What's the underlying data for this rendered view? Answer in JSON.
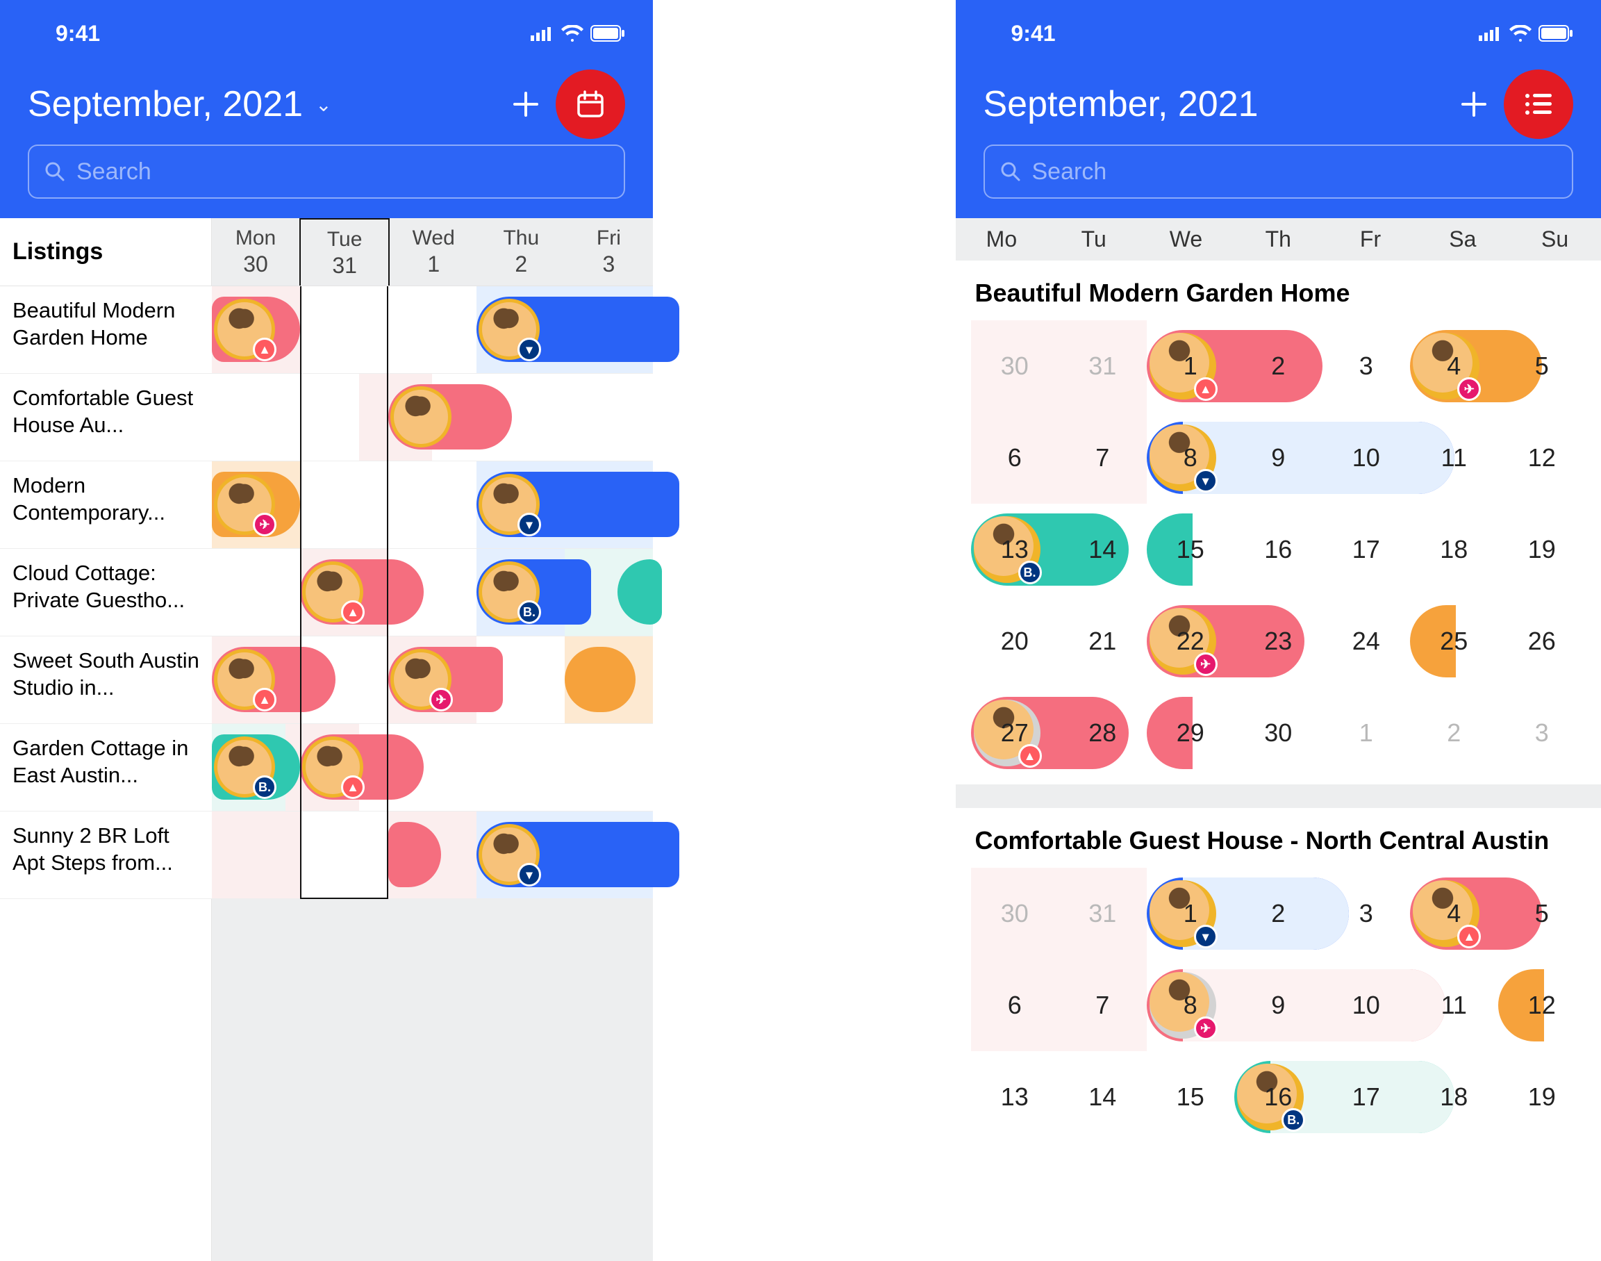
{
  "status": {
    "time": "9:41"
  },
  "header": {
    "title": "September, 2021",
    "search_placeholder": "Search"
  },
  "left": {
    "listings_heading": "Listings",
    "days": [
      {
        "name": "Mon",
        "num": "30"
      },
      {
        "name": "Tue",
        "num": "31"
      },
      {
        "name": "Wed",
        "num": "1"
      },
      {
        "name": "Thu",
        "num": "2"
      },
      {
        "name": "Fri",
        "num": "3"
      }
    ],
    "highlighted_day_index": 1,
    "rows": [
      {
        "label": "Beautiful Modern Garden Home",
        "cells": [
          "lt",
          "",
          "",
          "bl",
          "bl"
        ],
        "bookings": [
          {
            "start": 0,
            "span": 1,
            "color": "c-pink",
            "shape": "rnd-right",
            "badge": "airbnb",
            "badge_text": "▲"
          },
          {
            "start": 3,
            "span": 2.3,
            "color": "c-blue",
            "shape": "",
            "badge": "booking",
            "badge_text": "▾"
          }
        ]
      },
      {
        "label": "Comfortable Guest House Au...",
        "cells": [
          "",
          "",
          "lt",
          "",
          "",
          ""
        ],
        "bookings": [
          {
            "start": 2,
            "span": 1.4,
            "color": "c-pink",
            "shape": "rnd-both",
            "badge": "",
            "badge_text": ""
          }
        ]
      },
      {
        "label": "Modern Contemporary...",
        "cells": [
          "or",
          "",
          "",
          "bl",
          "bl"
        ],
        "bookings": [
          {
            "start": 0,
            "span": 1,
            "color": "c-orange",
            "shape": "rnd-right",
            "badge": "pink",
            "badge_text": "✈"
          },
          {
            "start": 3,
            "span": 2.3,
            "color": "c-blue",
            "shape": "",
            "badge": "booking",
            "badge_text": "▾"
          }
        ]
      },
      {
        "label": "Cloud Cottage: Private Guestho...",
        "cells": [
          "",
          "lt",
          "",
          "bl",
          "teal"
        ],
        "bookings": [
          {
            "start": 1,
            "span": 1.4,
            "color": "c-pink",
            "shape": "rnd-both",
            "badge": "airbnb",
            "badge_text": "▲"
          },
          {
            "start": 3,
            "span": 1.3,
            "color": "c-blue",
            "shape": "",
            "badge": "booking",
            "badge_text": "B."
          },
          {
            "start": 4.6,
            "span": 0.5,
            "color": "c-teal",
            "shape": "",
            "badge": "",
            "badge_text": "",
            "noav": true
          }
        ]
      },
      {
        "label": "Sweet South Austin Studio in...",
        "cells": [
          "lt",
          "",
          "lt",
          "",
          "or"
        ],
        "bookings": [
          {
            "start": 0,
            "span": 1.4,
            "color": "c-pink",
            "shape": "rnd-both",
            "badge": "airbnb",
            "badge_text": "▲"
          },
          {
            "start": 2,
            "span": 1.3,
            "color": "c-pink",
            "shape": "",
            "badge": "pink",
            "badge_text": "✈"
          },
          {
            "start": 4,
            "span": 0.8,
            "color": "c-orange",
            "shape": "rnd-both",
            "badge": "",
            "badge_text": "",
            "noav": true
          }
        ]
      },
      {
        "label": "Garden Cottage in East Austin...",
        "cells": [
          "teal",
          "lt",
          "",
          "",
          "",
          ""
        ],
        "bookings": [
          {
            "start": 0,
            "span": 1,
            "color": "c-teal",
            "shape": "rnd-right",
            "badge": "booking",
            "badge_text": "B."
          },
          {
            "start": 1,
            "span": 1.4,
            "color": "c-pink",
            "shape": "rnd-both",
            "badge": "airbnb",
            "badge_text": "▲"
          }
        ]
      },
      {
        "label": "Sunny 2 BR Loft Apt Steps from...",
        "cells": [
          "lt",
          "",
          "lt",
          "bl",
          "bl"
        ],
        "bookings": [
          {
            "start": 2,
            "span": 0.6,
            "color": "c-pink",
            "shape": "rnd-right",
            "badge": "",
            "badge_text": "",
            "noav": true
          },
          {
            "start": 3,
            "span": 2.3,
            "color": "c-blue",
            "shape": "",
            "badge": "booking",
            "badge_text": "▾"
          }
        ]
      }
    ]
  },
  "right": {
    "weekdays": [
      "Mo",
      "Tu",
      "We",
      "Th",
      "Fr",
      "Sa",
      "Su"
    ],
    "sections": [
      {
        "title": "Beautiful Modern Garden Home",
        "weeks": [
          {
            "days": [
              {
                "n": "30",
                "muted": true,
                "lt": true
              },
              {
                "n": "31",
                "muted": true,
                "lt": true
              },
              {
                "n": "1"
              },
              {
                "n": "2"
              },
              {
                "n": "3"
              },
              {
                "n": "4"
              },
              {
                "n": "5"
              }
            ],
            "bookings": [
              {
                "col": 2,
                "span": 2,
                "color": "c-pink",
                "badge": "airbnb",
                "bt": "▲"
              },
              {
                "col": 5,
                "span": 1.5,
                "color": "c-orange",
                "badge": "pink",
                "bt": "✈"
              }
            ]
          },
          {
            "days": [
              {
                "n": "6",
                "lt": true
              },
              {
                "n": "7",
                "lt": true
              },
              {
                "n": "8"
              },
              {
                "n": "9"
              },
              {
                "n": "10"
              },
              {
                "n": "11"
              },
              {
                "n": "12"
              }
            ],
            "bookings": [
              {
                "col": 2,
                "span": 3.5,
                "color": "c-blue",
                "badge": "booking",
                "bt": "▾",
                "tint": "#e4effe"
              }
            ]
          },
          {
            "days": [
              {
                "n": "13"
              },
              {
                "n": "14"
              },
              {
                "n": "15"
              },
              {
                "n": "16"
              },
              {
                "n": "17"
              },
              {
                "n": "18"
              },
              {
                "n": "19"
              }
            ],
            "bookings": [
              {
                "col": 0,
                "span": 1.8,
                "color": "c-teal",
                "badge": "booking",
                "bt": "B."
              },
              {
                "col": 2,
                "span": 0.5,
                "color": "c-teal",
                "half": "left"
              }
            ]
          },
          {
            "days": [
              {
                "n": "20"
              },
              {
                "n": "21"
              },
              {
                "n": "22"
              },
              {
                "n": "23"
              },
              {
                "n": "24"
              },
              {
                "n": "25"
              },
              {
                "n": "26"
              }
            ],
            "bookings": [
              {
                "col": 2,
                "span": 1.8,
                "color": "c-pink",
                "badge": "pink",
                "bt": "✈"
              },
              {
                "col": 5,
                "span": 0.5,
                "color": "c-orange",
                "half": "left"
              }
            ]
          },
          {
            "days": [
              {
                "n": "27"
              },
              {
                "n": "28"
              },
              {
                "n": "29"
              },
              {
                "n": "30"
              },
              {
                "n": "1",
                "muted": true
              },
              {
                "n": "2",
                "muted": true
              },
              {
                "n": "3",
                "muted": true
              }
            ],
            "bookings": [
              {
                "col": 0,
                "span": 1.8,
                "color": "c-pink",
                "badge": "airbnb",
                "bt": "▲",
                "avbg": "#d3d3d3"
              },
              {
                "col": 2,
                "span": 0.5,
                "color": "c-pink",
                "half": "left"
              }
            ]
          }
        ]
      },
      {
        "title": "Comfortable Guest House - North Central Austin",
        "weeks": [
          {
            "days": [
              {
                "n": "30",
                "muted": true,
                "lt": true
              },
              {
                "n": "31",
                "muted": true,
                "lt": true
              },
              {
                "n": "1"
              },
              {
                "n": "2"
              },
              {
                "n": "3"
              },
              {
                "n": "4"
              },
              {
                "n": "5"
              }
            ],
            "bookings": [
              {
                "col": 2,
                "span": 2.3,
                "color": "c-blue",
                "badge": "booking",
                "bt": "▾",
                "tint": "#e4effe"
              },
              {
                "col": 5,
                "span": 1.5,
                "color": "c-pink",
                "badge": "airbnb",
                "bt": "▲"
              }
            ]
          },
          {
            "days": [
              {
                "n": "6",
                "lt": true
              },
              {
                "n": "7",
                "lt": true
              },
              {
                "n": "8"
              },
              {
                "n": "9"
              },
              {
                "n": "10"
              },
              {
                "n": "11"
              },
              {
                "n": "12"
              }
            ],
            "bookings": [
              {
                "col": 2,
                "span": 3.4,
                "color": "c-pink",
                "badge": "pink",
                "bt": "✈",
                "tint": "#fdf2f2",
                "avbg": "#d3d3d3"
              },
              {
                "col": 6,
                "span": 0.5,
                "color": "c-orange",
                "half": "left"
              }
            ]
          },
          {
            "days": [
              {
                "n": "13"
              },
              {
                "n": "14"
              },
              {
                "n": "15"
              },
              {
                "n": "16"
              },
              {
                "n": "17"
              },
              {
                "n": "18"
              },
              {
                "n": "19"
              }
            ],
            "bookings": [
              {
                "col": 3,
                "span": 2.5,
                "color": "c-teal",
                "badge": "booking",
                "bt": "B.",
                "tint": "#e8f7f4"
              }
            ]
          }
        ]
      }
    ]
  }
}
